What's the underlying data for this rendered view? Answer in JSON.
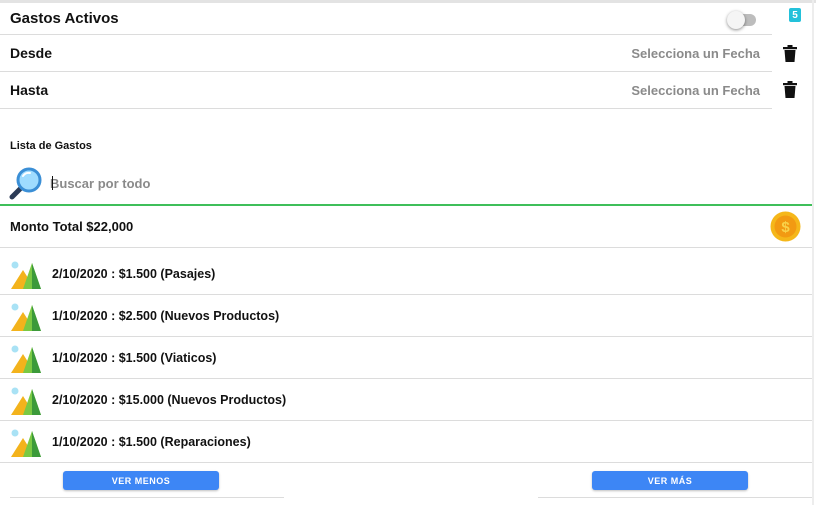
{
  "filters": {
    "active_label": "Gastos Activos",
    "badge_count": "5",
    "active_toggle_on": false,
    "from_label": "Desde",
    "from_placeholder": "Selecciona un Fecha",
    "to_label": "Hasta",
    "to_placeholder": "Selecciona un Fecha"
  },
  "list": {
    "title": "Lista de Gastos",
    "search_placeholder": "Buscar por todo",
    "total_label": "Monto Total $22,000",
    "items": [
      {
        "text": "2/10/2020 : $1.500 (Pasajes)"
      },
      {
        "text": "1/10/2020 : $2.500 (Nuevos Productos)"
      },
      {
        "text": "1/10/2020 : $1.500 (Viaticos)"
      },
      {
        "text": "2/10/2020 : $15.000 (Nuevos Productos)"
      },
      {
        "text": "1/10/2020 : $1.500 (Reparaciones)"
      }
    ]
  },
  "buttons": {
    "less_label": "VER MENOS",
    "more_label": "VER MÁS"
  },
  "colors": {
    "accent": "#3d86f5",
    "badge": "#23c1da",
    "search_underline": "#3fbf5a"
  },
  "icons": {
    "search": "magnifier-icon",
    "coin": "dollar-coin-icon",
    "item": "landscape-icon",
    "delete": "trash-icon"
  }
}
